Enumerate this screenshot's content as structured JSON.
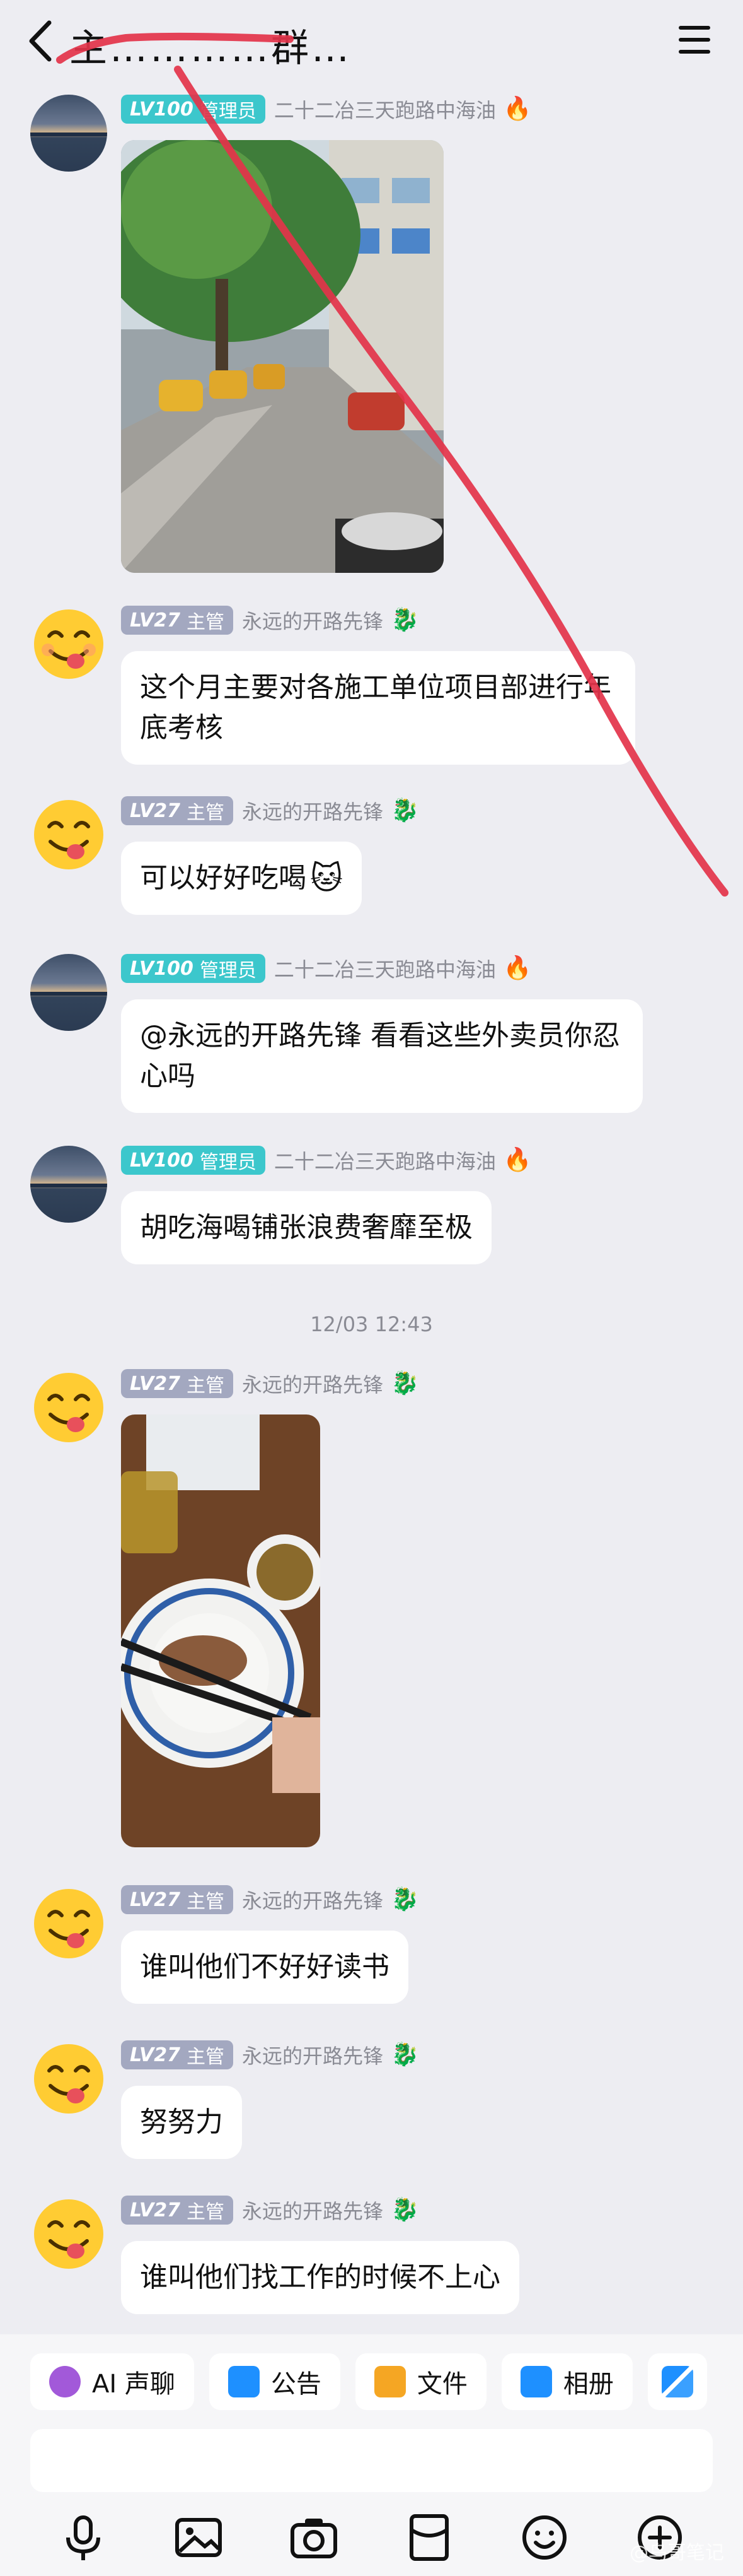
{
  "header": {
    "title": "主…………群…",
    "back_icon": "chevron-left-icon",
    "menu_icon": "menu-icon"
  },
  "roles": {
    "admin": {
      "level": "LV100",
      "title": "管理员",
      "nickname": "二十二冶三天跑路中海油",
      "icon": "flame-icon"
    },
    "host": {
      "level": "LV27",
      "title": "主管",
      "nickname": "永远的开路先锋",
      "icon": "dragon-icon"
    }
  },
  "messages": [
    {
      "role": "admin",
      "type": "image",
      "image": "street-photo"
    },
    {
      "role": "host",
      "type": "text",
      "lines": [
        "这个月主要对各施工单位项目部进行年",
        "底考核"
      ]
    },
    {
      "role": "host",
      "type": "text",
      "lines": [
        "可以好好吃喝"
      ]
    },
    {
      "role": "admin",
      "type": "text",
      "lines": [
        "@永远的开路先锋 看看这些外卖员你忍",
        "心吗"
      ]
    },
    {
      "role": "admin",
      "type": "text",
      "lines": [
        "胡吃海喝铺张浪费奢靡至极"
      ]
    },
    {
      "role": "host",
      "type": "image",
      "image": "meal-photo"
    },
    {
      "role": "host",
      "type": "text",
      "lines": [
        "谁叫他们不好好读书"
      ]
    },
    {
      "role": "host",
      "type": "text",
      "lines": [
        "努努力"
      ]
    },
    {
      "role": "host",
      "type": "text",
      "lines": [
        "谁叫他们找工作的时候不上心"
      ]
    }
  ],
  "timestamp": "12/03 12:43",
  "quick_actions": [
    {
      "label": "AI 声聊",
      "icon": "ai-voice-icon",
      "color": "#a259d9"
    },
    {
      "label": "公告",
      "icon": "announcement-icon",
      "color": "#1e90ff"
    },
    {
      "label": "文件",
      "icon": "folder-icon",
      "color": "#f5a623"
    },
    {
      "label": "相册",
      "icon": "album-icon",
      "color": "#1e90ff"
    }
  ],
  "input_placeholder": "",
  "bottom_tools": [
    "mic-icon",
    "image-icon",
    "camera-icon",
    "red-packet-icon",
    "emoji-icon",
    "plus-icon"
  ],
  "watermark": "@鸟哥笔记"
}
